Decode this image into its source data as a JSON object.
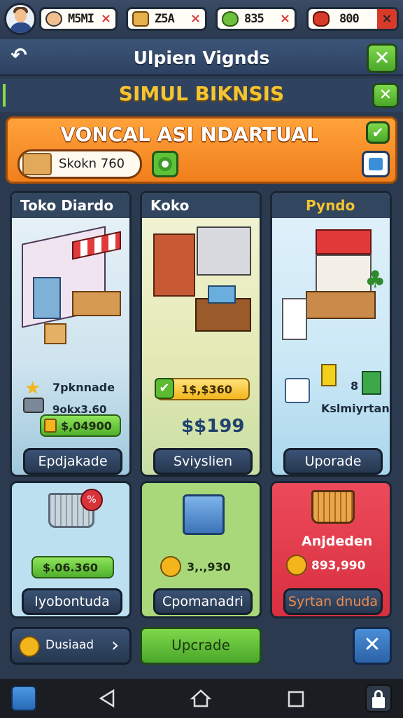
{
  "resources": [
    {
      "value": "M5MI",
      "icon": "avatar-icon"
    },
    {
      "value": "Z5A",
      "icon": "crate-icon"
    },
    {
      "value": "835",
      "icon": "money-bag-icon"
    },
    {
      "value": "800",
      "icon": "gem-icon"
    }
  ],
  "resource_close": "×",
  "header": {
    "title": "Ulpien Vignds"
  },
  "section": {
    "title": "SIMUL BIKNSIS"
  },
  "banner": {
    "title": "VONCAL ASI NDARTUAL",
    "stock": "Skokn 760"
  },
  "shops": [
    {
      "name": "Toko Diardo",
      "stat1": "7pknnade",
      "stat2": "9okx3.60",
      "price": "$,04900",
      "button": "Epdjakade"
    },
    {
      "name": "Koko",
      "price_tag": "1$,$360",
      "price": "$$199",
      "button": "Sviyslien"
    },
    {
      "name": "Pyndo",
      "count": "8",
      "label": "Kslmiyrtan",
      "button": "Uporade"
    }
  ],
  "items": [
    {
      "price": "$.06.360",
      "button": "Iyobontuda",
      "badge": "%"
    },
    {
      "price": "3,.,930",
      "button": "Cpomanadri"
    },
    {
      "title": "Anjdeden",
      "price": "893,990",
      "button": "Syrtan dnuda"
    }
  ],
  "footer": {
    "left_label": "Dusiaad",
    "chevron": "›",
    "upgrade": "Upcrade",
    "close": "✕"
  },
  "colors": {
    "accent_orange": "#f28a22",
    "gold": "#f4c430",
    "green": "#5dbb32",
    "red_card": "#e84050",
    "blue_card": "#bde0f0",
    "green_card": "#a8d87a"
  }
}
